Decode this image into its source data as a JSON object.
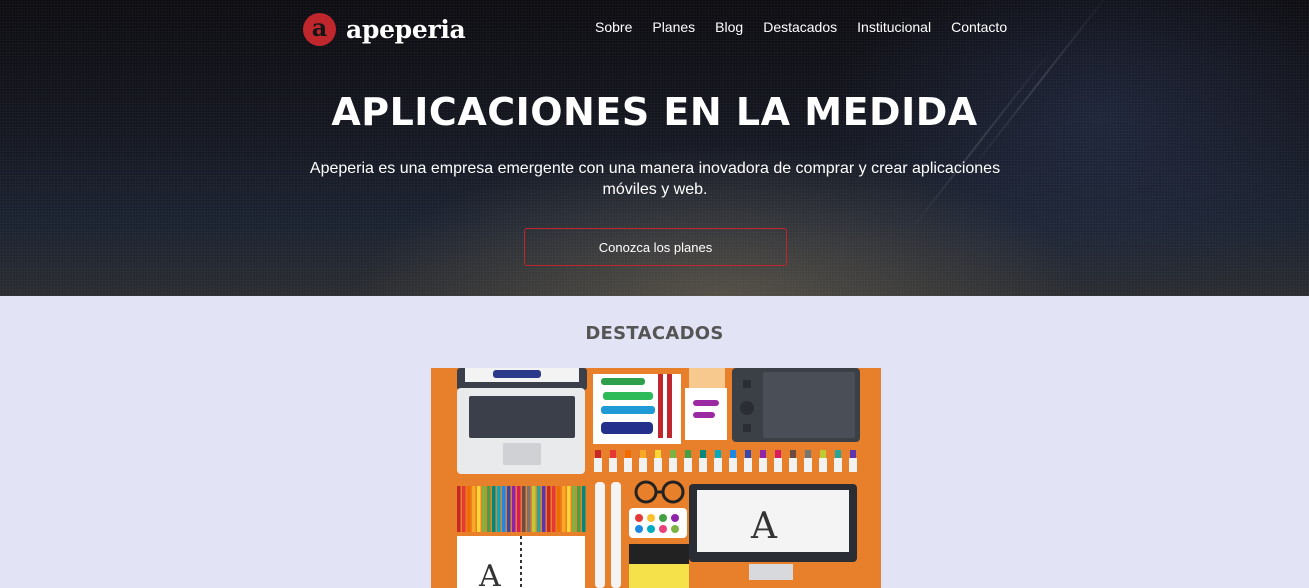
{
  "brand": {
    "logo_letter": "a",
    "name": "apeperia",
    "accent": "#c0272d"
  },
  "nav": {
    "items": [
      "Sobre",
      "Planes",
      "Blog",
      "Destacados",
      "Institucional",
      "Contacto"
    ]
  },
  "hero": {
    "title": "APLICACIONES EN LA MEDIDA",
    "subtitle": "Apeperia es una empresa emergente con una manera inovadora de comprar y crear aplicaciones móviles y web.",
    "cta_label": "Conozca los planes"
  },
  "featured": {
    "title": "DESTACADOS",
    "image_bg": "#e87f2b"
  }
}
